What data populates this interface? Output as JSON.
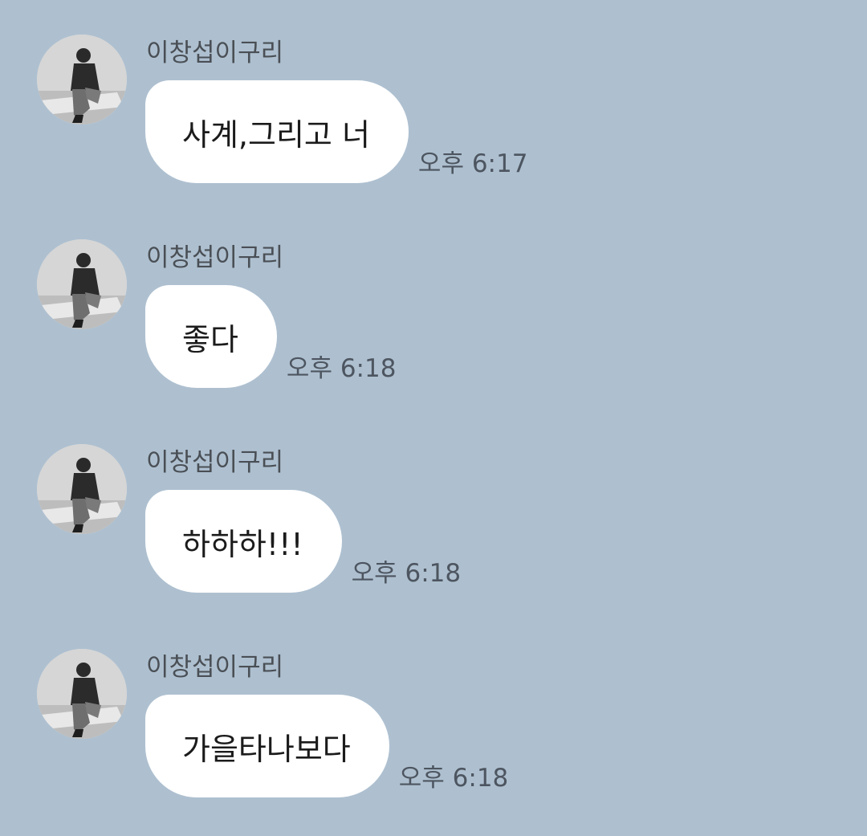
{
  "messages": [
    {
      "sender": "이창섭이구리",
      "text": "사계,그리고 너",
      "time": "오후 6:17"
    },
    {
      "sender": "이창섭이구리",
      "text": "좋다",
      "time": "오후 6:18"
    },
    {
      "sender": "이창섭이구리",
      "text": "하하하!!!",
      "time": "오후 6:18"
    },
    {
      "sender": "이창섭이구리",
      "text": "가을타나보다",
      "time": "오후 6:18"
    }
  ],
  "colors": {
    "background": "#aec0d0",
    "bubble": "#ffffff",
    "sender_text": "#4a4f55",
    "time_text": "#4d5560"
  }
}
